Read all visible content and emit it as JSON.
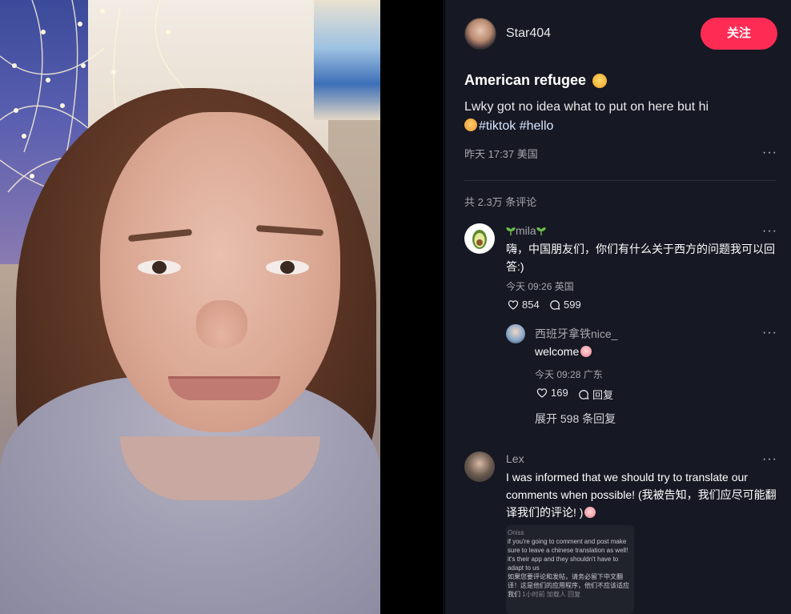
{
  "author": {
    "name": "Star404",
    "follow_label": "关注"
  },
  "post": {
    "title": "American refugee",
    "title_emoji": "face-emoji",
    "description": "Lwky got no idea what to put on here but hi",
    "tags": [
      "#tiktok",
      "#hello"
    ],
    "meta": "昨天 17:37 美国"
  },
  "comments_count_label": "共 2.3万 条评论",
  "comments": [
    {
      "name": "mila",
      "text": "嗨，中国朋友们，你们有什么关于西方的问题我可以回答:)",
      "meta": "今天 09:26 英国",
      "likes": "854",
      "replies": "599",
      "avatar_icon": "avocado-icon"
    },
    {
      "name": "西班牙拿铁nice_",
      "text": "welcome",
      "meta": "今天 09:28 广东",
      "likes": "169",
      "reply_label": "回复"
    },
    {
      "name": "Lex",
      "text": "I was informed that we should try to translate our comments when possible! (我被告知，我们应尽可能翻译我们的评论! )"
    }
  ],
  "expand_label": "展开 598 条回复",
  "screenshot": {
    "user": "Oniss",
    "lines": [
      "if you're going to comment and post make",
      "sure to leave a chinese translation as well!",
      "it's their app and they shouldn't have to",
      "adapt to us",
      "如果您要评论和发帖，请务必留下中文翻",
      "译！这是他们的应用程序，他们不应该适应",
      "我们"
    ],
    "footer": "1小时前   加载人   回复"
  },
  "colors": {
    "accent": "#fe2c55",
    "panel_bg": "#161823"
  }
}
